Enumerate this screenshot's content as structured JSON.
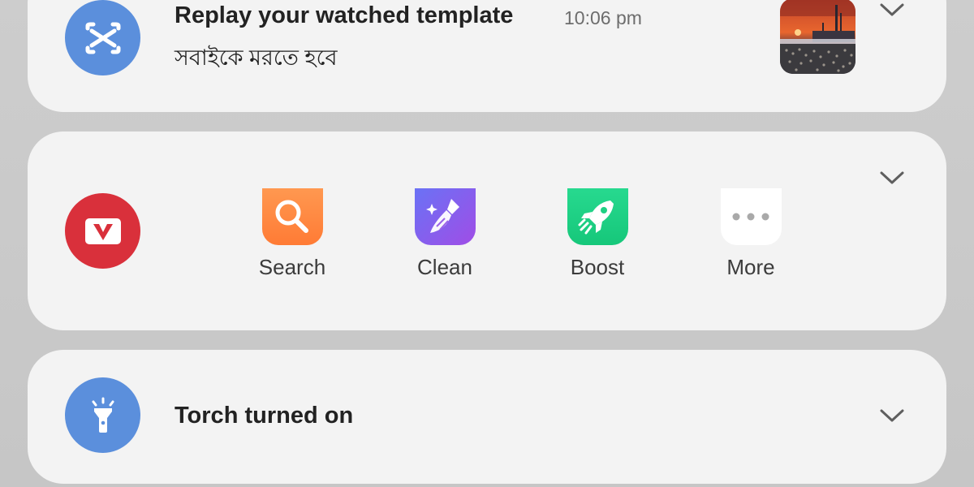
{
  "notifications": [
    {
      "app_icon": "capcut-icon",
      "title": "Replay your watched template",
      "time": "10:06 pm",
      "body": "সবাইকে মরতে হবে",
      "thumbnail": "mosque-sunset-thumbnail",
      "expand_icon": "chevron-down-icon"
    },
    {
      "app_icon": "vidmate-icon",
      "actions": [
        {
          "label": "Search",
          "icon": "search-icon",
          "color": "#ff8a40"
        },
        {
          "label": "Clean",
          "icon": "broom-icon",
          "color": "#8a5cf0"
        },
        {
          "label": "Boost",
          "icon": "rocket-icon",
          "color": "#1fd083"
        },
        {
          "label": "More",
          "icon": "more-dots-icon",
          "color": "#ffffff"
        }
      ],
      "expand_icon": "chevron-down-icon"
    },
    {
      "app_icon": "flashlight-icon",
      "title": "Torch turned on",
      "expand_icon": "chevron-down-icon"
    }
  ],
  "colors": {
    "app_icon_blue": "#5b8fdc",
    "vidmate_red": "#d9303b",
    "card_background": "#f3f3f3",
    "page_background": "#c9c9c9"
  }
}
